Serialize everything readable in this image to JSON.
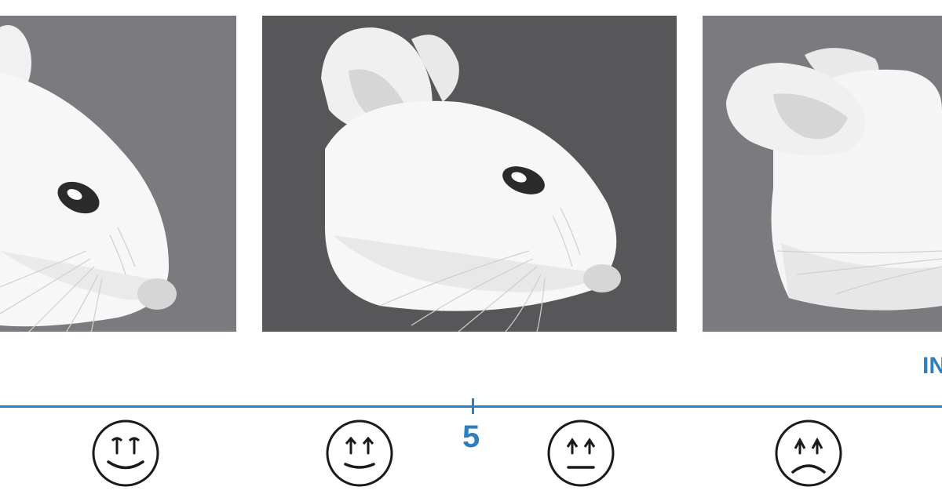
{
  "colors": {
    "accent_blue": "#2f7fbf",
    "panel_light": "#7b7b7f",
    "panel_dark": "#575759",
    "face_stroke": "#1a1a1a"
  },
  "panels": [
    {
      "subject": "mouse-head-relaxed",
      "background": "#7b7b7f"
    },
    {
      "subject": "mouse-head-ears-back",
      "background": "#575759"
    },
    {
      "subject": "mouse-head-eyes-closed",
      "background": "#7b7b7f"
    }
  ],
  "scale": {
    "tick_label": "5",
    "edge_label": "IN"
  },
  "faces": [
    "happy-face-icon",
    "slightly-happy-face-icon",
    "neutral-face-icon",
    "sad-face-icon"
  ]
}
